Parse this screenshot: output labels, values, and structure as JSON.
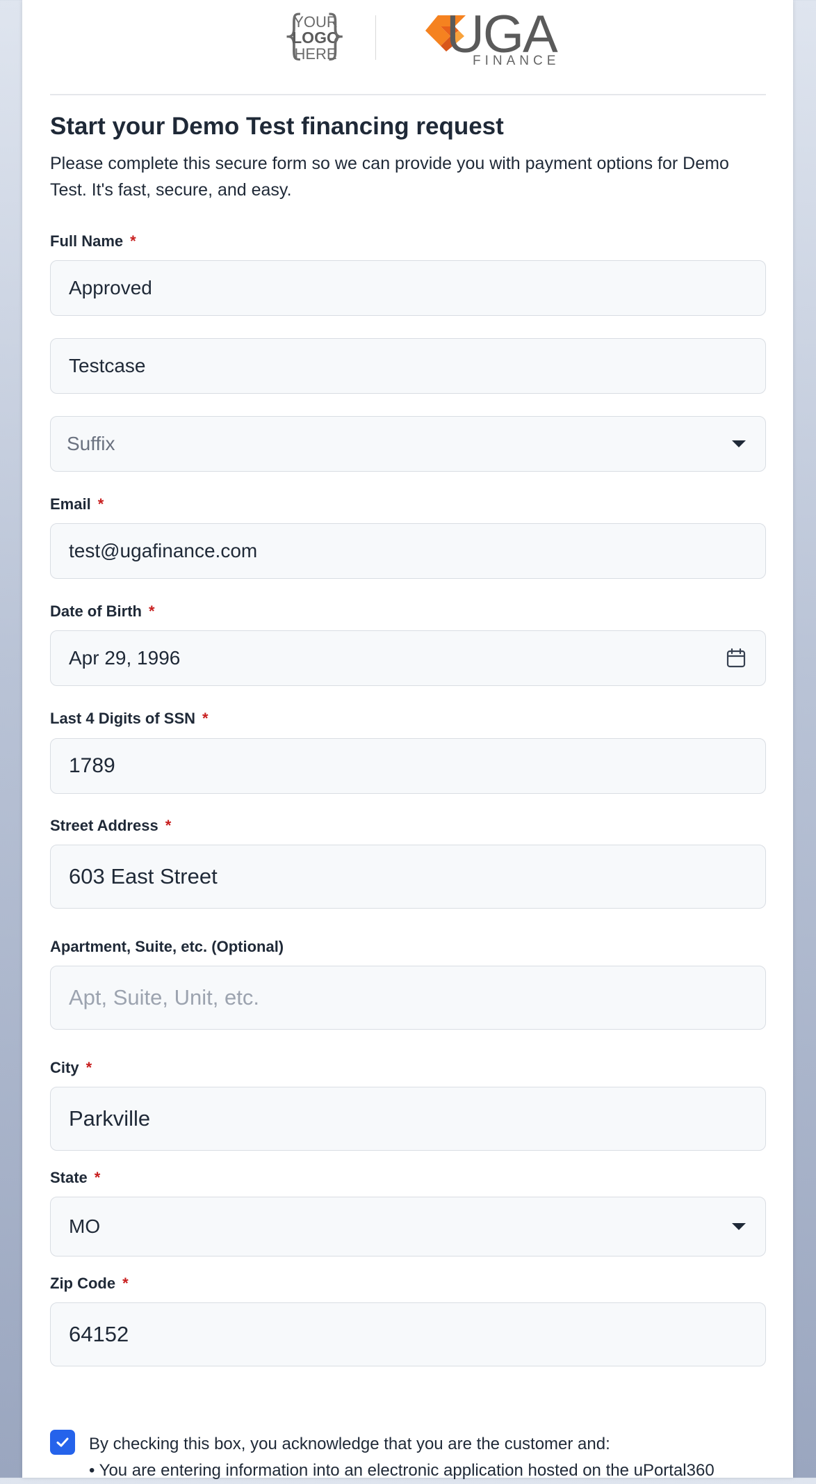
{
  "header": {
    "placeholder_logo": {
      "line1": "YOUR",
      "line2": "LOGO",
      "line3": "HERE"
    },
    "brand_logo": {
      "name": "UGA",
      "subtitle": "FINANCE"
    }
  },
  "form": {
    "title": "Start your Demo Test financing request",
    "intro": "Please complete this secure form so we can provide you with payment options for Demo Test. It's fast, secure, and easy.",
    "required_marker": "*",
    "full_name": {
      "label": "Full Name",
      "first_value": "Approved",
      "last_value": "Testcase",
      "suffix_placeholder": "Suffix"
    },
    "email": {
      "label": "Email",
      "value": "test@ugafinance.com"
    },
    "dob": {
      "label": "Date of Birth",
      "value": "Apr 29, 1996"
    },
    "ssn": {
      "label": "Last 4 Digits of SSN",
      "value": "1789"
    },
    "street": {
      "label": "Street Address",
      "value": "603 East Street"
    },
    "apt": {
      "label": "Apartment, Suite, etc. (Optional)",
      "placeholder": "Apt, Suite, Unit, etc."
    },
    "city": {
      "label": "City",
      "value": "Parkville"
    },
    "state": {
      "label": "State",
      "value": "MO"
    },
    "zip": {
      "label": "Zip Code",
      "value": "64152"
    },
    "consent": {
      "checked": true,
      "line1": "By checking this box, you acknowledge that you are the customer and:",
      "line2": "• You are entering information into an electronic application hosted on the uPortal360"
    }
  },
  "colors": {
    "accent": "#2563eb",
    "required": "#c81e1e",
    "brand_orange": "#f58220",
    "field_bg": "#f7f9fb"
  },
  "icons": {
    "calendar": "calendar-icon",
    "dropdown": "chevron-down-icon",
    "check": "checkmark-icon"
  }
}
